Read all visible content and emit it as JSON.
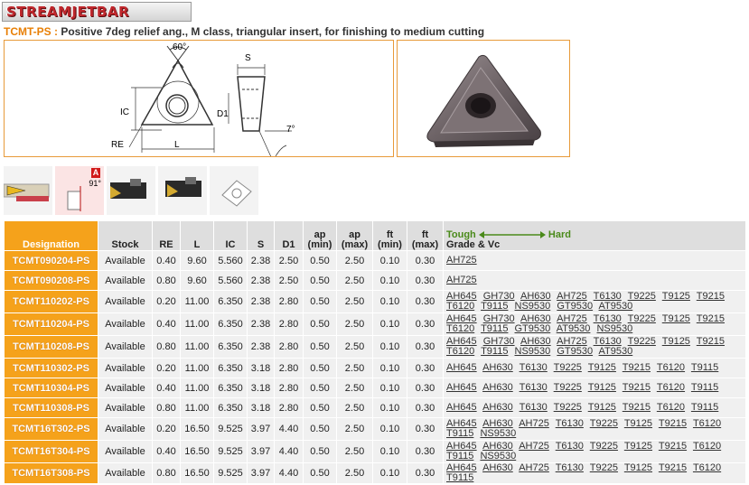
{
  "logo": {
    "text": "STREAMJETBAR"
  },
  "subtitle": {
    "code": "TCMT-PS :",
    "description": "Positive 7deg relief ang., M class, triangular insert, for finishing to medium cutting"
  },
  "drawing": {
    "angle_label": "60°",
    "s_label": "S",
    "ic_label": "IC",
    "d1_label": "D1",
    "re_label": "RE",
    "l_label": "L",
    "relief_label": "7°"
  },
  "thumbs": {
    "selected_badge": "A",
    "selected_angle": "91°"
  },
  "table": {
    "headers": {
      "designation": "Designation",
      "stock": "Stock",
      "re": "RE",
      "l": "L",
      "ic": "IC",
      "s": "S",
      "d1": "D1",
      "ap_min_1": "ap",
      "ap_min_2": "(min)",
      "ap_max_1": "ap",
      "ap_max_2": "(max)",
      "ft_min_1": "ft",
      "ft_min_2": "(min)",
      "ft_max_1": "ft",
      "ft_max_2": "(max)",
      "tough": "Tough",
      "hard": "Hard",
      "grade": "Grade & Vc"
    },
    "rows": [
      {
        "designation": "TCMT090204-PS",
        "stock": "Available",
        "re": "0.40",
        "l": "9.60",
        "ic": "5.560",
        "s": "2.38",
        "d1": "2.50",
        "ap_min": "0.50",
        "ap_max": "2.50",
        "ft_min": "0.10",
        "ft_max": "0.30",
        "grades": [
          "AH725"
        ]
      },
      {
        "designation": "TCMT090208-PS",
        "stock": "Available",
        "re": "0.80",
        "l": "9.60",
        "ic": "5.560",
        "s": "2.38",
        "d1": "2.50",
        "ap_min": "0.50",
        "ap_max": "2.50",
        "ft_min": "0.10",
        "ft_max": "0.30",
        "grades": [
          "AH725"
        ]
      },
      {
        "designation": "TCMT110202-PS",
        "stock": "Available",
        "re": "0.20",
        "l": "11.00",
        "ic": "6.350",
        "s": "2.38",
        "d1": "2.80",
        "ap_min": "0.50",
        "ap_max": "2.50",
        "ft_min": "0.10",
        "ft_max": "0.30",
        "grades": [
          "AH645",
          "GH730",
          "AH630",
          "AH725",
          "T6130",
          "T9225",
          "T9125",
          "T9215",
          "T6120",
          "T9115",
          "NS9530",
          "GT9530",
          "AT9530"
        ]
      },
      {
        "designation": "TCMT110204-PS",
        "stock": "Available",
        "re": "0.40",
        "l": "11.00",
        "ic": "6.350",
        "s": "2.38",
        "d1": "2.80",
        "ap_min": "0.50",
        "ap_max": "2.50",
        "ft_min": "0.10",
        "ft_max": "0.30",
        "grades": [
          "AH645",
          "GH730",
          "AH630",
          "AH725",
          "T6130",
          "T9225",
          "T9125",
          "T9215",
          "T6120",
          "T9115",
          "GT9530",
          "AT9530",
          "NS9530"
        ]
      },
      {
        "designation": "TCMT110208-PS",
        "stock": "Available",
        "re": "0.80",
        "l": "11.00",
        "ic": "6.350",
        "s": "2.38",
        "d1": "2.80",
        "ap_min": "0.50",
        "ap_max": "2.50",
        "ft_min": "0.10",
        "ft_max": "0.30",
        "grades": [
          "AH645",
          "GH730",
          "AH630",
          "AH725",
          "T6130",
          "T9225",
          "T9125",
          "T9215",
          "T6120",
          "T9115",
          "NS9530",
          "GT9530",
          "AT9530"
        ]
      },
      {
        "designation": "TCMT110302-PS",
        "stock": "Available",
        "re": "0.20",
        "l": "11.00",
        "ic": "6.350",
        "s": "3.18",
        "d1": "2.80",
        "ap_min": "0.50",
        "ap_max": "2.50",
        "ft_min": "0.10",
        "ft_max": "0.30",
        "grades": [
          "AH645",
          "AH630",
          "T6130",
          "T9225",
          "T9125",
          "T9215",
          "T6120",
          "T9115"
        ]
      },
      {
        "designation": "TCMT110304-PS",
        "stock": "Available",
        "re": "0.40",
        "l": "11.00",
        "ic": "6.350",
        "s": "3.18",
        "d1": "2.80",
        "ap_min": "0.50",
        "ap_max": "2.50",
        "ft_min": "0.10",
        "ft_max": "0.30",
        "grades": [
          "AH645",
          "AH630",
          "T6130",
          "T9225",
          "T9125",
          "T9215",
          "T6120",
          "T9115"
        ]
      },
      {
        "designation": "TCMT110308-PS",
        "stock": "Available",
        "re": "0.80",
        "l": "11.00",
        "ic": "6.350",
        "s": "3.18",
        "d1": "2.80",
        "ap_min": "0.50",
        "ap_max": "2.50",
        "ft_min": "0.10",
        "ft_max": "0.30",
        "grades": [
          "AH645",
          "AH630",
          "T6130",
          "T9225",
          "T9125",
          "T9215",
          "T6120",
          "T9115"
        ]
      },
      {
        "designation": "TCMT16T302-PS",
        "stock": "Available",
        "re": "0.20",
        "l": "16.50",
        "ic": "9.525",
        "s": "3.97",
        "d1": "4.40",
        "ap_min": "0.50",
        "ap_max": "2.50",
        "ft_min": "0.10",
        "ft_max": "0.30",
        "grades": [
          "AH645",
          "AH630",
          "AH725",
          "T6130",
          "T9225",
          "T9125",
          "T9215",
          "T6120",
          "T9115",
          "NS9530"
        ]
      },
      {
        "designation": "TCMT16T304-PS",
        "stock": "Available",
        "re": "0.40",
        "l": "16.50",
        "ic": "9.525",
        "s": "3.97",
        "d1": "4.40",
        "ap_min": "0.50",
        "ap_max": "2.50",
        "ft_min": "0.10",
        "ft_max": "0.30",
        "grades": [
          "AH645",
          "AH630",
          "AH725",
          "T6130",
          "T9225",
          "T9125",
          "T9215",
          "T6120",
          "T9115",
          "NS9530"
        ]
      },
      {
        "designation": "TCMT16T308-PS",
        "stock": "Available",
        "re": "0.80",
        "l": "16.50",
        "ic": "9.525",
        "s": "3.97",
        "d1": "4.40",
        "ap_min": "0.50",
        "ap_max": "2.50",
        "ft_min": "0.10",
        "ft_max": "0.30",
        "grades": [
          "AH645",
          "AH630",
          "AH725",
          "T6130",
          "T9225",
          "T9125",
          "T9215",
          "T6120",
          "T9115"
        ]
      }
    ]
  }
}
